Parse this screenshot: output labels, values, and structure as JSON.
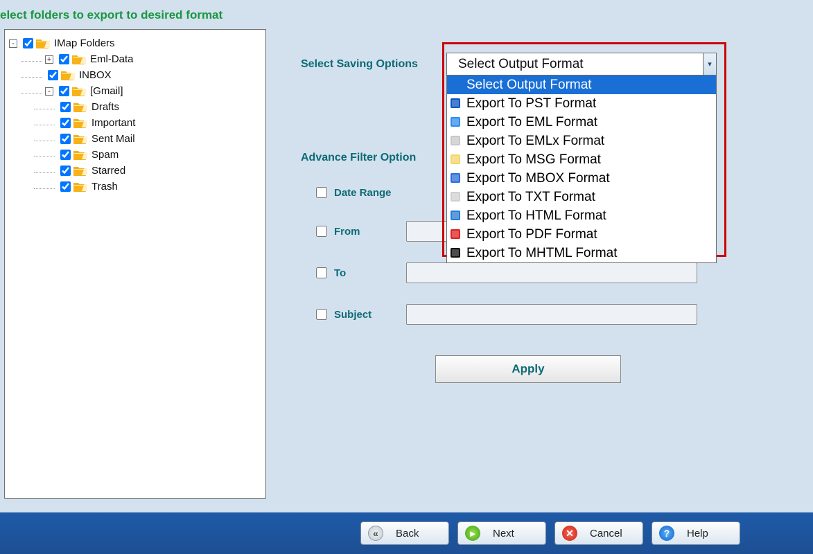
{
  "page": {
    "title": "elect folders to export to desired format"
  },
  "tree": {
    "items": [
      {
        "name": "IMap Folders",
        "checked": true,
        "depth": 0,
        "toggle": "-"
      },
      {
        "name": "Eml-Data",
        "checked": true,
        "depth": 1,
        "toggle": "+"
      },
      {
        "name": "INBOX",
        "checked": true,
        "depth": 1,
        "toggle": ""
      },
      {
        "name": "[Gmail]",
        "checked": true,
        "depth": 1,
        "toggle": "-"
      },
      {
        "name": "Drafts",
        "checked": true,
        "depth": 2,
        "toggle": ""
      },
      {
        "name": "Important",
        "checked": true,
        "depth": 2,
        "toggle": ""
      },
      {
        "name": "Sent Mail",
        "checked": true,
        "depth": 2,
        "toggle": ""
      },
      {
        "name": "Spam",
        "checked": true,
        "depth": 2,
        "toggle": ""
      },
      {
        "name": "Starred",
        "checked": true,
        "depth": 2,
        "toggle": ""
      },
      {
        "name": "Trash",
        "checked": true,
        "depth": 2,
        "toggle": ""
      }
    ]
  },
  "saving": {
    "label": "Select Saving Options",
    "selected": "Select Output Format",
    "options": [
      {
        "name": "Select Output Format",
        "highlighted": true,
        "icon": "none"
      },
      {
        "name": "Export To PST Format",
        "icon": "pst",
        "color": "#0a56c2"
      },
      {
        "name": "Export To EML Format",
        "icon": "eml",
        "color": "#2f8eeb"
      },
      {
        "name": "Export To EMLx Format",
        "icon": "emlx",
        "color": "#c8c8c8"
      },
      {
        "name": "Export To MSG Format",
        "icon": "msg",
        "color": "#f3d66b"
      },
      {
        "name": "Export To MBOX Format",
        "icon": "mbox",
        "color": "#2b6fd8"
      },
      {
        "name": "Export To TXT Format",
        "icon": "txt",
        "color": "#d0d0d0"
      },
      {
        "name": "Export To HTML Format",
        "icon": "html",
        "color": "#2a7bd3"
      },
      {
        "name": "Export To PDF Format",
        "icon": "pdf",
        "color": "#d22"
      },
      {
        "name": "Export To MHTML Format",
        "icon": "mhtml",
        "color": "#111"
      }
    ]
  },
  "filters": {
    "section_label": "Advance Filter Option",
    "date_range_label": "Date Range",
    "from_label": "From",
    "to_label": "To",
    "subject_label": "Subject",
    "apply_label": "Apply"
  },
  "footer": {
    "back": "Back",
    "next": "Next",
    "cancel": "Cancel",
    "help": "Help"
  }
}
